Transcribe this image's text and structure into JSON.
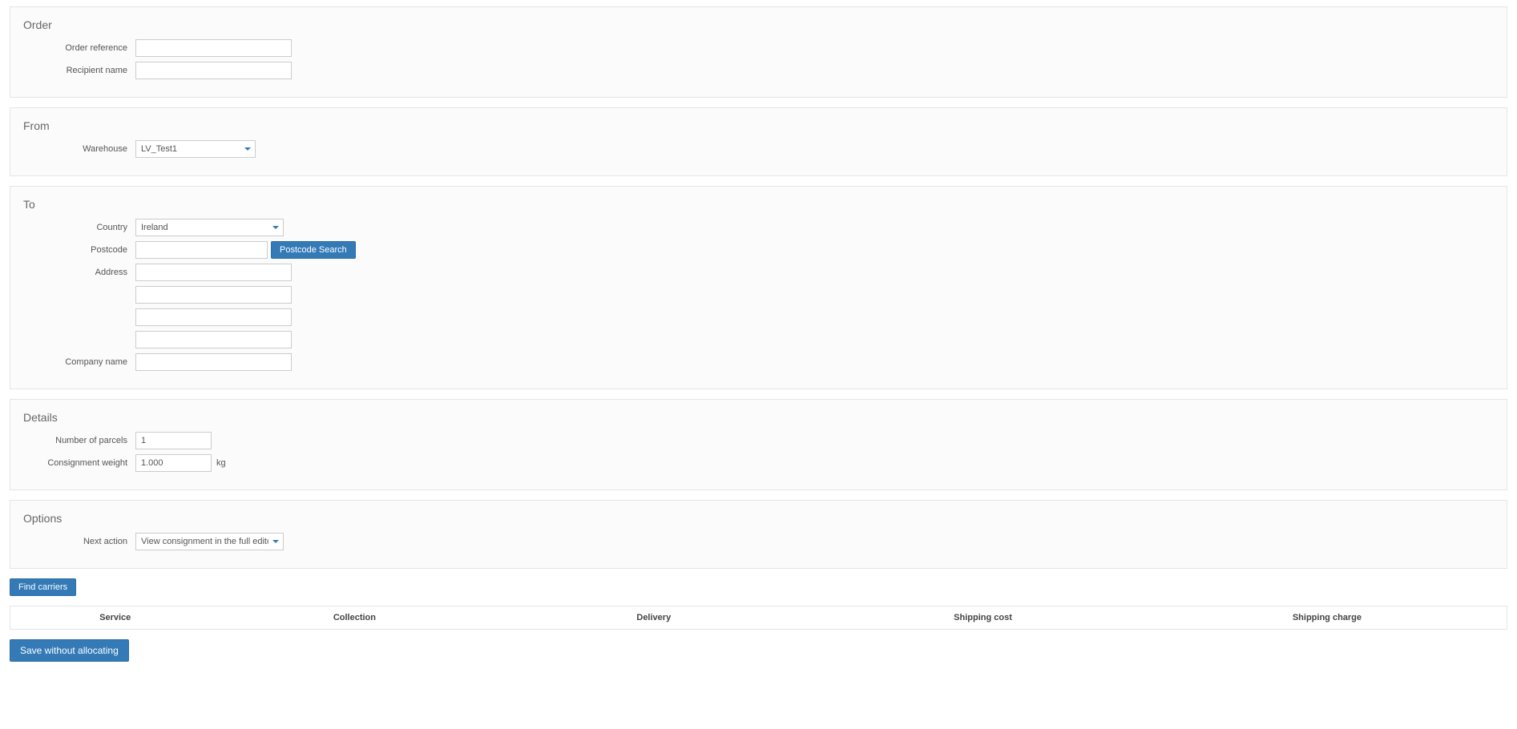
{
  "order": {
    "title": "Order",
    "order_ref_label": "Order reference",
    "order_ref_value": "",
    "recipient_label": "Recipient name",
    "recipient_value": ""
  },
  "from": {
    "title": "From",
    "warehouse_label": "Warehouse",
    "warehouse_value": "LV_Test1"
  },
  "to": {
    "title": "To",
    "country_label": "Country",
    "country_value": "Ireland",
    "postcode_label": "Postcode",
    "postcode_value": "",
    "postcode_search_btn": "Postcode Search",
    "address_label": "Address",
    "address1": "",
    "address2": "",
    "address3": "",
    "address4": "",
    "company_label": "Company name",
    "company_value": ""
  },
  "details": {
    "title": "Details",
    "parcels_label": "Number of parcels",
    "parcels_value": "1",
    "weight_label": "Consignment weight",
    "weight_value": "1.000",
    "weight_unit": "kg"
  },
  "options": {
    "title": "Options",
    "next_action_label": "Next action",
    "next_action_value": "View consignment in the full editor"
  },
  "actions": {
    "find_carriers": "Find carriers",
    "save_without_allocating": "Save without allocating"
  },
  "table": {
    "headers": {
      "service": "Service",
      "collection": "Collection",
      "delivery": "Delivery",
      "shipping_cost": "Shipping cost",
      "shipping_charge": "Shipping charge"
    }
  }
}
